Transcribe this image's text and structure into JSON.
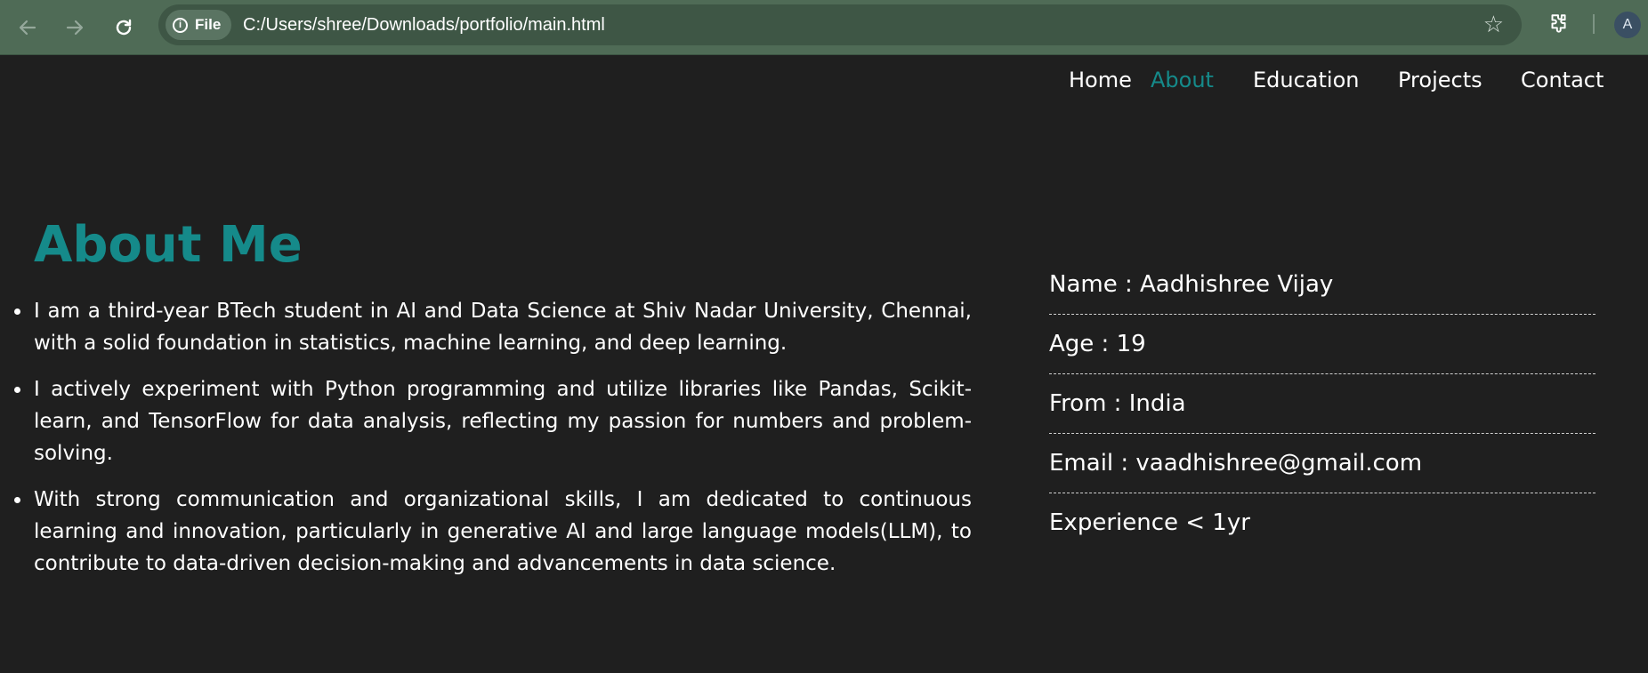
{
  "browser": {
    "back_icon": "arrow-left-icon",
    "forward_icon": "arrow-right-icon",
    "reload_icon": "reload-icon",
    "site_chip_label": "File",
    "url": "C:/Users/shree/Downloads/portfolio/main.html",
    "bookmark_icon": "star-icon",
    "extensions_icon": "puzzle-icon",
    "profile_initial": "A"
  },
  "nav": {
    "items": [
      {
        "label": "Home",
        "active": false
      },
      {
        "label": "About",
        "active": true
      },
      {
        "label": "Education",
        "active": false
      },
      {
        "label": "Projects",
        "active": false
      },
      {
        "label": "Contact",
        "active": false
      }
    ]
  },
  "about": {
    "title": "About Me",
    "bullets": [
      "I am a third-year BTech student in AI and Data Science at Shiv Nadar University, Chennai, with a solid foundation in statistics, machine learning, and deep learning.",
      "I actively experiment with Python programming and utilize libraries like Pandas, Scikit-learn, and TensorFlow for data analysis, reflecting my passion for numbers and problem-solving.",
      "With strong communication and organizational skills, I am dedicated to continuous learning and innovation, particularly in generative AI and large language models(LLM), to contribute to data-driven decision-making and advancements in data science."
    ]
  },
  "info": {
    "name": "Name : Aadhishree Vijay",
    "age": "Age : 19",
    "from": "From : India",
    "email": "Email : vaadhishree@gmail.com",
    "experience": "Experience < 1yr"
  },
  "colors": {
    "accent": "#158a8a",
    "page_background": "#1f1f1f",
    "chrome_background": "#4f6b56"
  }
}
